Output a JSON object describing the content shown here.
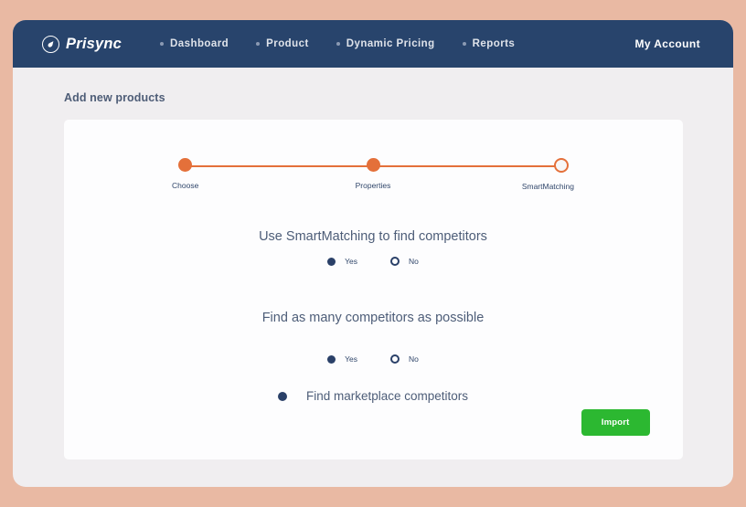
{
  "navbar": {
    "brand": {
      "name": "Prisync",
      "icon": "prisync-logo-icon"
    },
    "links": [
      {
        "label": "Dashboard"
      },
      {
        "label": "Product"
      },
      {
        "label": "Dynamic Pricing"
      },
      {
        "label": "Reports"
      }
    ],
    "account_label": "My Account"
  },
  "page": {
    "title": "Add new products"
  },
  "stepper": {
    "steps": [
      {
        "label": "Choose",
        "state": "complete"
      },
      {
        "label": "Properties",
        "state": "complete"
      },
      {
        "label": "SmartMatching",
        "state": "current"
      }
    ]
  },
  "questions": [
    {
      "text": "Use SmartMatching to find competitors",
      "options": [
        {
          "label": "Yes",
          "selected": true
        },
        {
          "label": "No",
          "selected": false
        }
      ]
    },
    {
      "text": "Find as many competitors as possible",
      "options": [
        {
          "label": "Yes",
          "selected": true
        },
        {
          "label": "No",
          "selected": false
        }
      ]
    }
  ],
  "marketplace": {
    "label": "Find marketplace competitors",
    "selected": true
  },
  "footer": {
    "import_label": "Import"
  },
  "colors": {
    "page_background": "#e9b9a3",
    "navbar": "#28446c",
    "app_background": "#f0eef0",
    "card": "#fdfdfe",
    "accent_orange": "#e4703a",
    "navy_text": "#31476b",
    "import_green": "#2cb831"
  }
}
